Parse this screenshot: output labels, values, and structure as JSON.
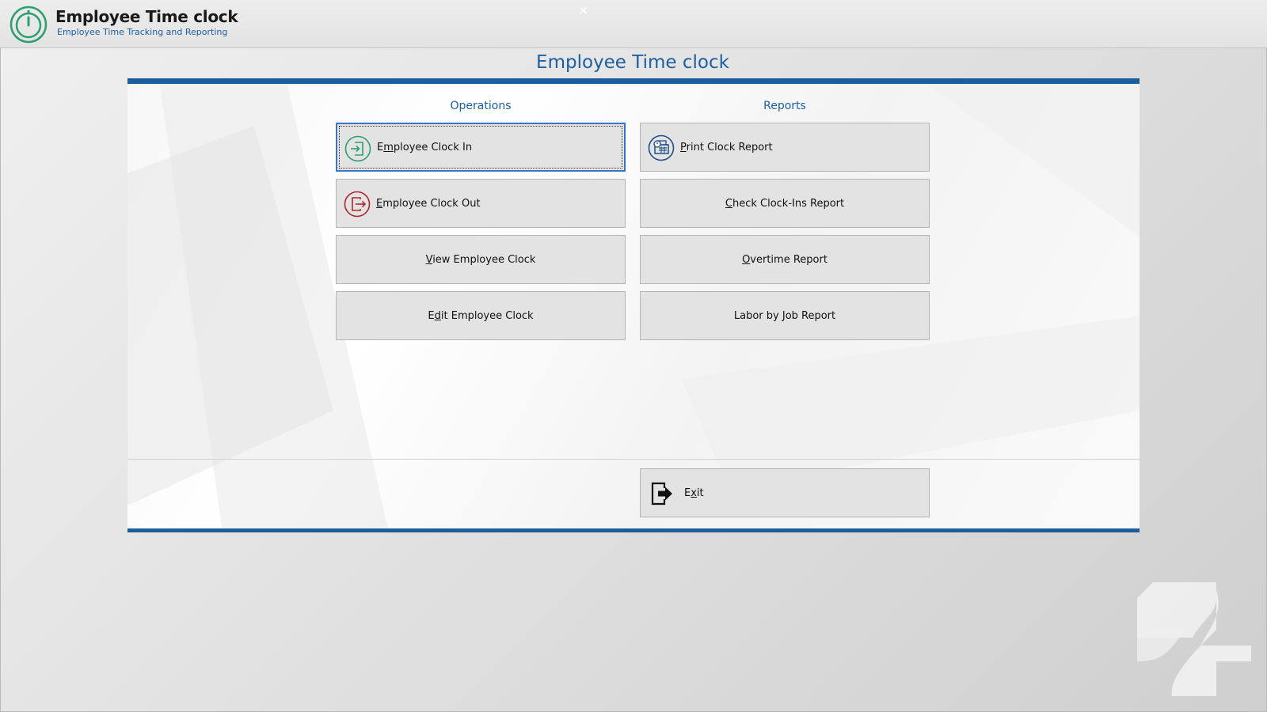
{
  "app": {
    "title": "Employee Time clock",
    "subtitle": "Employee Time Tracking and Reporting",
    "close_glyph": "×",
    "logo_icon": "stopwatch-icon"
  },
  "main": {
    "title": "Employee Time clock",
    "operations": {
      "heading": "Operations",
      "buttons": [
        {
          "pre": "E",
          "key": "m",
          "post": "ployee Clock In",
          "icon": "clock-in-icon",
          "focused": true
        },
        {
          "pre": "",
          "key": "E",
          "post": "mployee Clock Out",
          "icon": "clock-out-icon"
        },
        {
          "pre": "",
          "key": "V",
          "post": "iew Employee Clock"
        },
        {
          "pre": "E",
          "key": "d",
          "post": "it Employee Clock"
        }
      ]
    },
    "reports": {
      "heading": "Reports",
      "buttons": [
        {
          "pre": "",
          "key": "P",
          "post": "rint Clock Report",
          "icon": "print-report-icon"
        },
        {
          "pre": "",
          "key": "C",
          "post": "heck Clock-Ins Report"
        },
        {
          "pre": "",
          "key": "O",
          "post": "vertime Report"
        },
        {
          "pre": "Labor by ",
          "key": "J",
          "post": "ob Report"
        }
      ]
    },
    "exit": {
      "pre": "E",
      "key": "x",
      "post": "it",
      "icon": "exit-icon"
    }
  },
  "colors": {
    "accent_blue": "#1d5d9b",
    "heading_blue": "#1d5fa0",
    "clock_in_green": "#2e9e6f",
    "clock_out_red": "#b0282e",
    "button_face": "#e3e3e3"
  }
}
